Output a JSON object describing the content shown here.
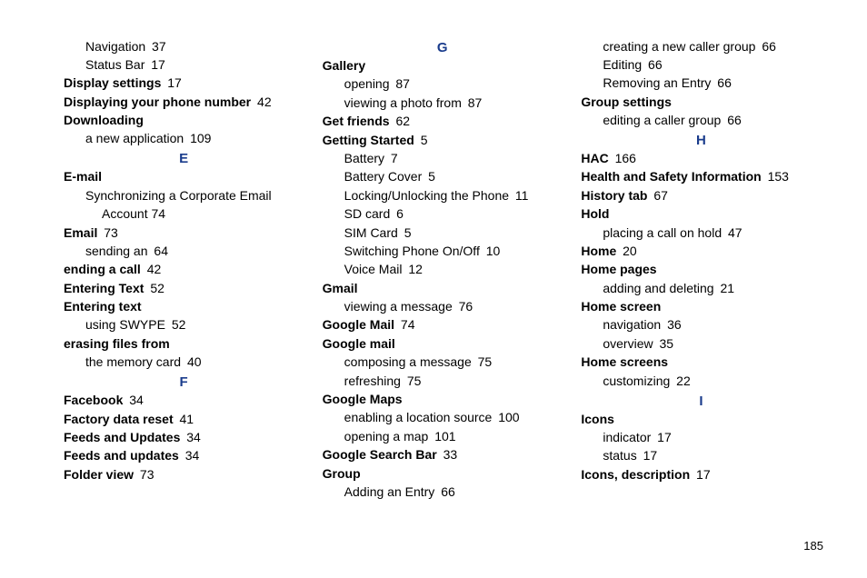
{
  "page_number": "185",
  "columns": [
    {
      "items": [
        {
          "type": "sub",
          "label": "Navigation",
          "page": "37"
        },
        {
          "type": "sub",
          "label": "Status Bar",
          "page": "17"
        },
        {
          "type": "main",
          "label": "Display settings",
          "page": "17"
        },
        {
          "type": "main",
          "label": "Displaying your phone number",
          "page": "42"
        },
        {
          "type": "main",
          "label": "Downloading",
          "page": ""
        },
        {
          "type": "sub",
          "label": "a new application",
          "page": "109"
        },
        {
          "type": "letter",
          "label": "E"
        },
        {
          "type": "main",
          "label": "E-mail",
          "page": ""
        },
        {
          "type": "sub",
          "label": "Synchronizing a Corporate Email",
          "page": ""
        },
        {
          "type": "sub2",
          "label": "Account",
          "page": "74"
        },
        {
          "type": "main",
          "label": "Email",
          "page": "73"
        },
        {
          "type": "sub",
          "label": "sending an",
          "page": "64"
        },
        {
          "type": "main",
          "label": "ending a call",
          "page": "42"
        },
        {
          "type": "main",
          "label": "Entering Text",
          "page": "52"
        },
        {
          "type": "main",
          "label": "Entering text",
          "page": ""
        },
        {
          "type": "sub",
          "label": "using SWYPE",
          "page": "52"
        },
        {
          "type": "main",
          "label": "erasing files from",
          "page": ""
        },
        {
          "type": "sub",
          "label": "the memory card",
          "page": "40"
        },
        {
          "type": "letter",
          "label": "F"
        },
        {
          "type": "main",
          "label": "Facebook",
          "page": "34"
        },
        {
          "type": "main",
          "label": "Factory data reset",
          "page": "41"
        },
        {
          "type": "main",
          "label": "Feeds and Updates",
          "page": "34"
        },
        {
          "type": "main",
          "label": "Feeds and updates",
          "page": "34"
        },
        {
          "type": "main",
          "label": "Folder view",
          "page": "73"
        }
      ]
    },
    {
      "items": [
        {
          "type": "letter",
          "label": "G"
        },
        {
          "type": "main",
          "label": "Gallery",
          "page": ""
        },
        {
          "type": "sub",
          "label": "opening",
          "page": "87"
        },
        {
          "type": "sub",
          "label": "viewing a photo from",
          "page": "87"
        },
        {
          "type": "main",
          "label": "Get friends",
          "page": "62"
        },
        {
          "type": "main",
          "label": "Getting Started",
          "page": "5"
        },
        {
          "type": "sub",
          "label": "Battery",
          "page": "7"
        },
        {
          "type": "sub",
          "label": "Battery Cover",
          "page": "5"
        },
        {
          "type": "sub",
          "label": "Locking/Unlocking the Phone",
          "page": "11"
        },
        {
          "type": "sub",
          "label": "SD card",
          "page": "6"
        },
        {
          "type": "sub",
          "label": "SIM Card",
          "page": "5"
        },
        {
          "type": "sub",
          "label": "Switching Phone On/Off",
          "page": "10"
        },
        {
          "type": "sub",
          "label": "Voice Mail",
          "page": "12"
        },
        {
          "type": "main",
          "label": "Gmail",
          "page": ""
        },
        {
          "type": "sub",
          "label": "viewing a message",
          "page": "76"
        },
        {
          "type": "main",
          "label": "Google Mail",
          "page": "74"
        },
        {
          "type": "main",
          "label": "Google mail",
          "page": ""
        },
        {
          "type": "sub",
          "label": "composing a message",
          "page": "75"
        },
        {
          "type": "sub",
          "label": "refreshing",
          "page": "75"
        },
        {
          "type": "main",
          "label": "Google Maps",
          "page": ""
        },
        {
          "type": "sub",
          "label": "enabling a location source",
          "page": "100"
        },
        {
          "type": "sub",
          "label": "opening a map",
          "page": "101"
        },
        {
          "type": "main",
          "label": "Google Search Bar",
          "page": "33"
        },
        {
          "type": "main",
          "label": "Group",
          "page": ""
        },
        {
          "type": "sub",
          "label": "Adding an Entry",
          "page": "66"
        }
      ]
    },
    {
      "items": [
        {
          "type": "sub",
          "label": "creating a new caller group",
          "page": "66"
        },
        {
          "type": "sub",
          "label": "Editing",
          "page": "66"
        },
        {
          "type": "sub",
          "label": "Removing an Entry",
          "page": "66"
        },
        {
          "type": "main",
          "label": "Group settings",
          "page": ""
        },
        {
          "type": "sub",
          "label": "editing a caller group",
          "page": "66"
        },
        {
          "type": "letter",
          "label": "H"
        },
        {
          "type": "main",
          "label": "HAC",
          "page": "166"
        },
        {
          "type": "main",
          "label": "Health and Safety Information",
          "page": "153"
        },
        {
          "type": "main",
          "label": "History tab",
          "page": "67"
        },
        {
          "type": "main",
          "label": "Hold",
          "page": ""
        },
        {
          "type": "sub",
          "label": "placing a call on hold",
          "page": "47"
        },
        {
          "type": "main",
          "label": "Home",
          "page": "20"
        },
        {
          "type": "main",
          "label": "Home pages",
          "page": ""
        },
        {
          "type": "sub",
          "label": "adding and deleting",
          "page": "21"
        },
        {
          "type": "main",
          "label": "Home screen",
          "page": ""
        },
        {
          "type": "sub",
          "label": "navigation",
          "page": "36"
        },
        {
          "type": "sub",
          "label": "overview",
          "page": "35"
        },
        {
          "type": "main",
          "label": "Home screens",
          "page": ""
        },
        {
          "type": "sub",
          "label": "customizing",
          "page": "22"
        },
        {
          "type": "letter",
          "label": "I"
        },
        {
          "type": "main",
          "label": "Icons",
          "page": ""
        },
        {
          "type": "sub",
          "label": "indicator",
          "page": "17"
        },
        {
          "type": "sub",
          "label": "status",
          "page": "17"
        },
        {
          "type": "main",
          "label": "Icons, description",
          "page": "17"
        }
      ]
    }
  ]
}
